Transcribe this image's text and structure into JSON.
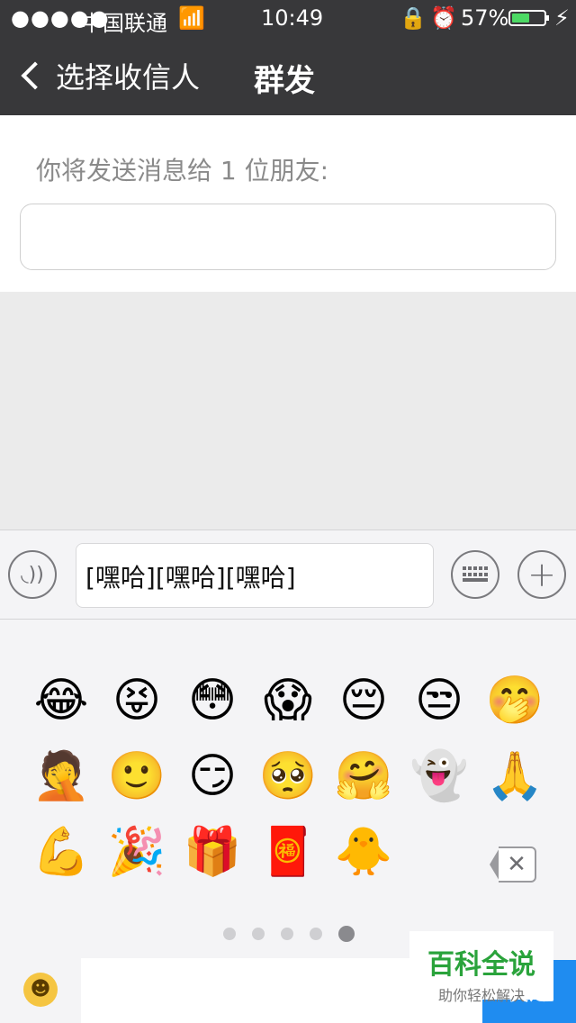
{
  "status_bar": {
    "signal": "●●●●●",
    "carrier": "中国联通",
    "time": "10:49",
    "battery": "57%",
    "battery_level": 0.57,
    "battery_color": "#4cd964"
  },
  "nav": {
    "back_label": "选择收信人",
    "title": "群发"
  },
  "recipients": {
    "hint": "你将发送消息给 1 位朋友:"
  },
  "composer": {
    "text": "[嘿哈][嘿哈][嘿哈]"
  },
  "emoji_panel": {
    "items": [
      "😂",
      "😝",
      "😳",
      "😱",
      "😔",
      "😒",
      "🤭",
      "🤦",
      "🙂",
      "😏",
      "🥺",
      "🤗",
      "👻",
      "🙏",
      "💪",
      "🎉",
      "🎁",
      "🧧",
      "🐥"
    ],
    "pages": 5,
    "current_page": 5
  },
  "bottom": {
    "send_label": "发送"
  },
  "watermark": {
    "title": "百科全说",
    "subtitle": "助你轻松解决"
  },
  "colors": {
    "nav_bg": "#38383a",
    "send_blue": "#1f8cf0",
    "watermark_green": "#2aa33b"
  }
}
